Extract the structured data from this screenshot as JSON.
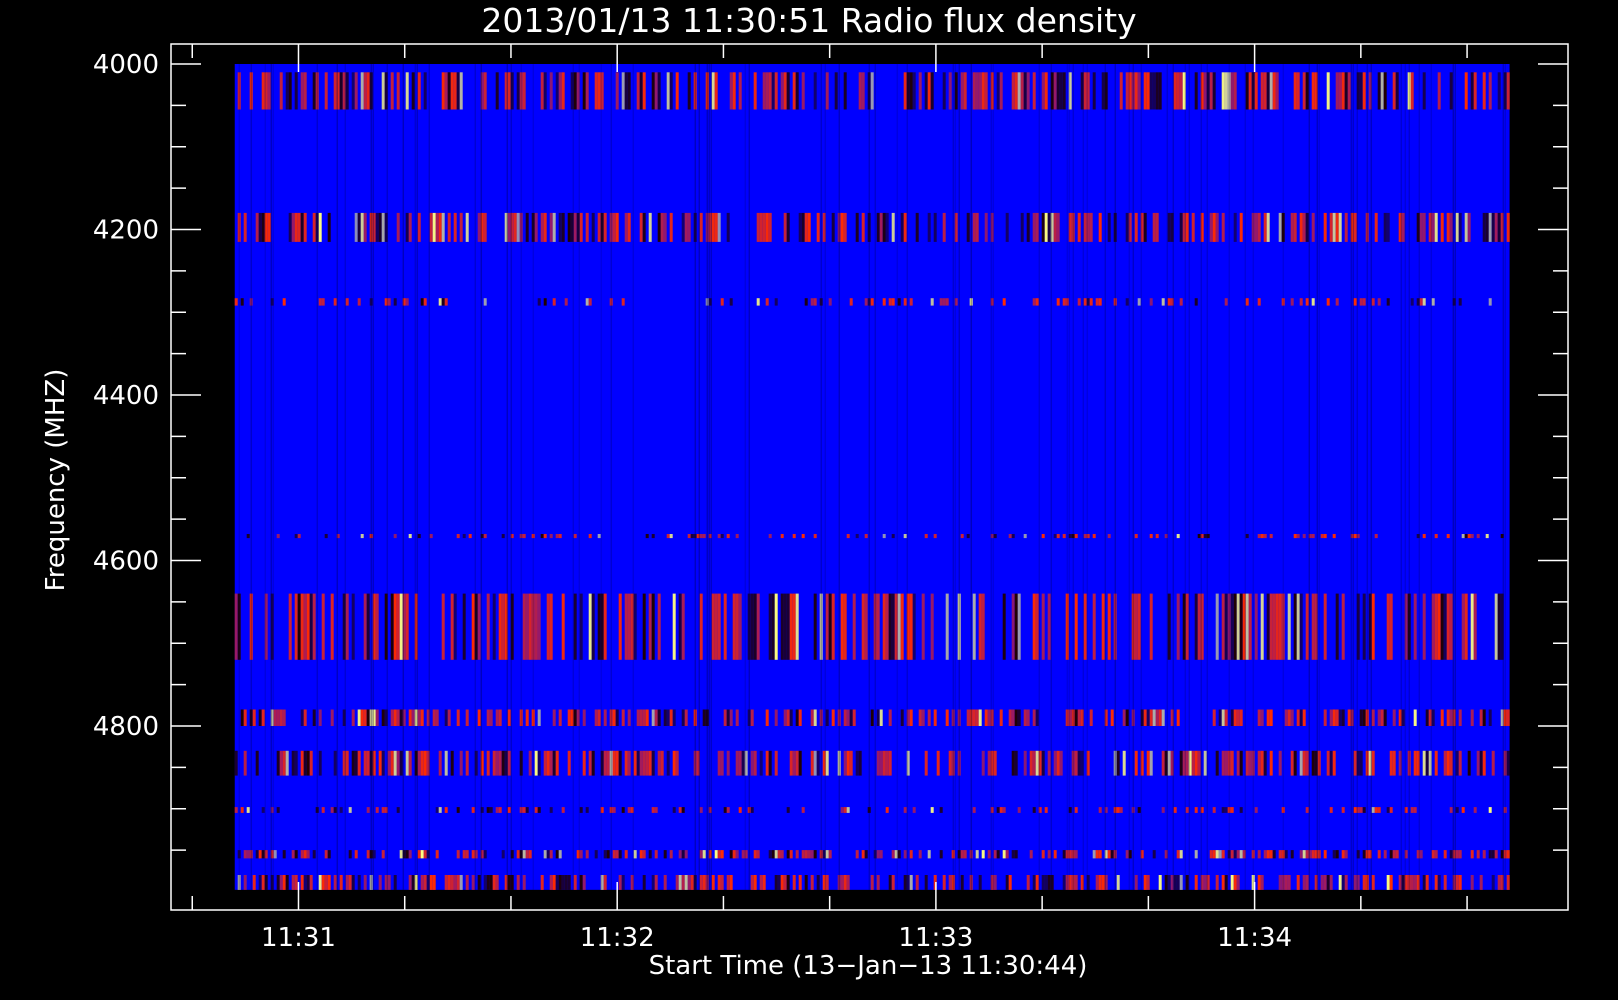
{
  "chart_data": {
    "type": "heatmap",
    "title": "2013/01/13 11:30:51 Radio flux density",
    "xlabel": "Start Time (13−Jan−13 11:30:44)",
    "ylabel": "Frequency (MHZ)",
    "x_range": [
      "11:30:36",
      "11:34:59"
    ],
    "data_x_range": [
      "11:30:48",
      "11:34:48"
    ],
    "y_range": [
      4000,
      5030
    ],
    "data_y_range": [
      4000,
      4998
    ],
    "y_reversed": true,
    "x_ticks": [
      "11:31",
      "11:32",
      "11:33",
      "11:34"
    ],
    "y_ticks": [
      4000,
      4200,
      4400,
      4600,
      4800
    ],
    "colors": {
      "background": "#000000",
      "axes": "#ffffff",
      "low": "#0000ff",
      "high": "#ff2a00",
      "peak": "#ffff80"
    },
    "bands": [
      {
        "from": 4010,
        "to": 4055,
        "intensity": "high"
      },
      {
        "from": 4180,
        "to": 4215,
        "intensity": "high"
      },
      {
        "from": 4283,
        "to": 4292,
        "intensity": "medium"
      },
      {
        "from": 4568,
        "to": 4573,
        "intensity": "medium"
      },
      {
        "from": 4640,
        "to": 4720,
        "intensity": "high"
      },
      {
        "from": 4780,
        "to": 4800,
        "intensity": "high"
      },
      {
        "from": 4830,
        "to": 4860,
        "intensity": "high"
      },
      {
        "from": 4898,
        "to": 4905,
        "intensity": "medium"
      },
      {
        "from": 4950,
        "to": 4960,
        "intensity": "high"
      },
      {
        "from": 4980,
        "to": 4998,
        "intensity": "high"
      }
    ]
  }
}
